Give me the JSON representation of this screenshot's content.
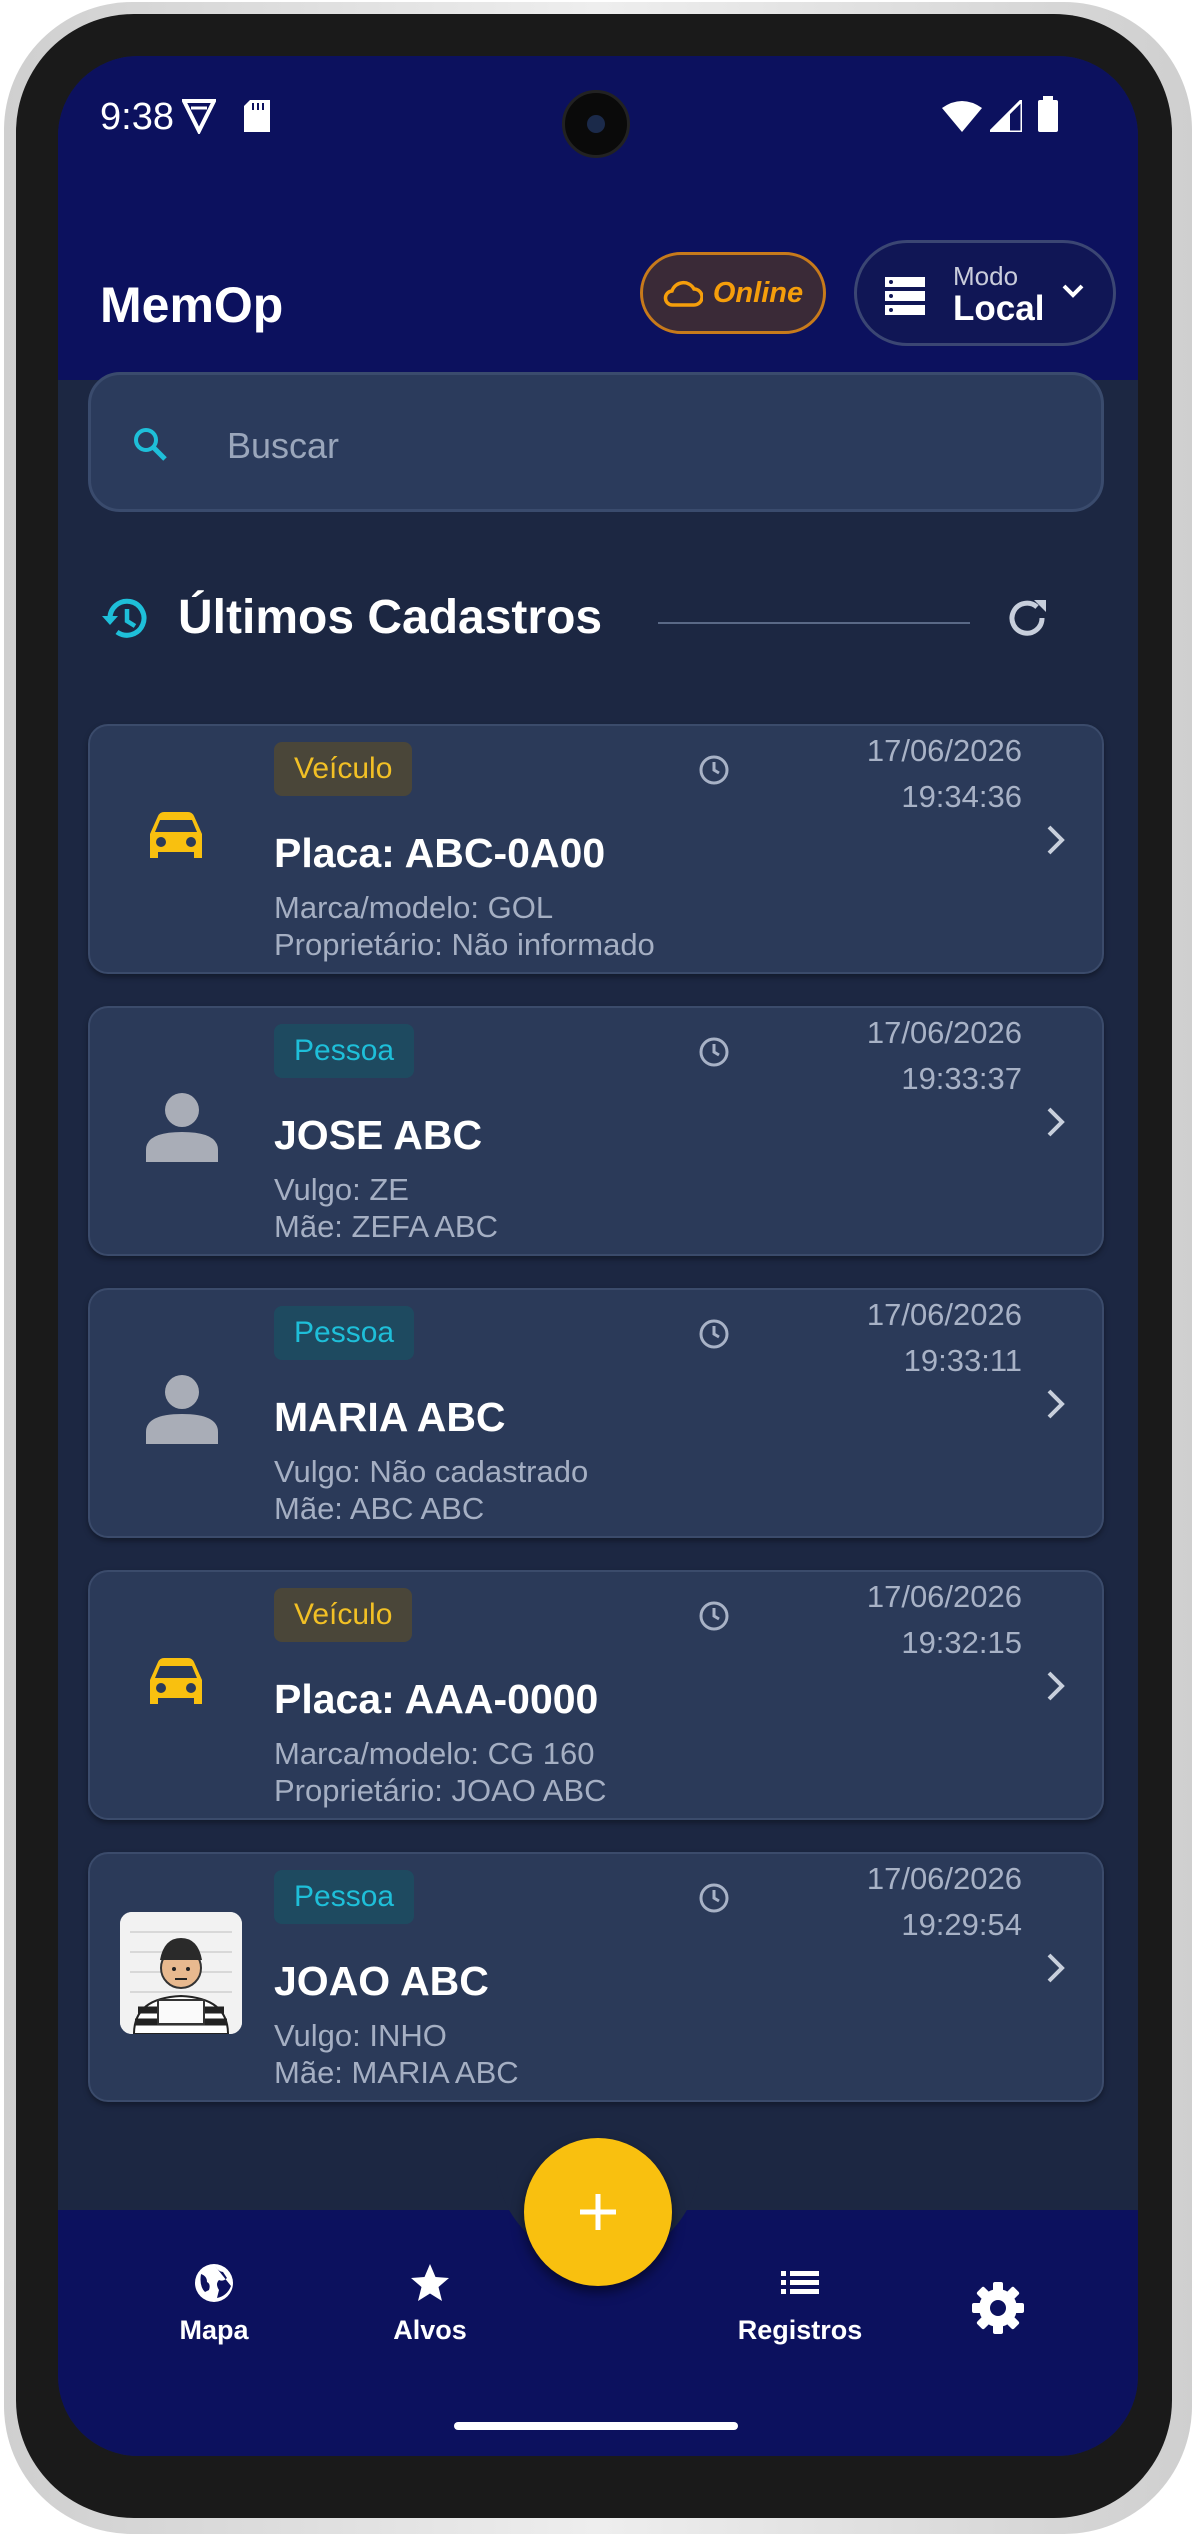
{
  "status_bar": {
    "time": "9:38"
  },
  "app_bar": {
    "title": "MemOp",
    "connection_status": "Online",
    "mode_label": "Modo",
    "mode_value": "Local"
  },
  "search": {
    "placeholder": "Buscar"
  },
  "section": {
    "title": "Últimos Cadastros"
  },
  "records": [
    {
      "type": "Veículo",
      "kind": "vehicle",
      "title": "Placa: ABC-0A00",
      "line1": "Marca/modelo: GOL",
      "line2": "Proprietário: Não informado",
      "date": "17/06/2026",
      "time": "19:34:36",
      "icon": "car-icon"
    },
    {
      "type": "Pessoa",
      "kind": "person",
      "title": "JOSE ABC",
      "line1": "Vulgo: ZE",
      "line2": "Mãe: ZEFA ABC",
      "date": "17/06/2026",
      "time": "19:33:37",
      "icon": "person-icon"
    },
    {
      "type": "Pessoa",
      "kind": "person",
      "title": "MARIA ABC",
      "line1": "Vulgo: Não cadastrado",
      "line2": "Mãe: ABC ABC",
      "date": "17/06/2026",
      "time": "19:33:11",
      "icon": "person-icon"
    },
    {
      "type": "Veículo",
      "kind": "vehicle",
      "title": "Placa: AAA-0000",
      "line1": "Marca/modelo: CG 160",
      "line2": "Proprietário: JOAO ABC",
      "date": "17/06/2026",
      "time": "19:32:15",
      "icon": "car-icon"
    },
    {
      "type": "Pessoa",
      "kind": "person",
      "title": "JOAO ABC",
      "line1": "Vulgo: INHO",
      "line2": "Mãe: MARIA ABC",
      "date": "17/06/2026",
      "time": "19:29:54",
      "icon": "mugshot-photo"
    }
  ],
  "bottom_nav": {
    "mapa": "Mapa",
    "alvos": "Alvos",
    "registros": "Registros"
  },
  "colors": {
    "app_bar": "#0c115e",
    "background": "#1c2742",
    "card": "#2b3a59",
    "accent_yellow": "#f9c00f",
    "accent_cyan": "#1ebfd9",
    "online_orange": "#f59e0b"
  }
}
